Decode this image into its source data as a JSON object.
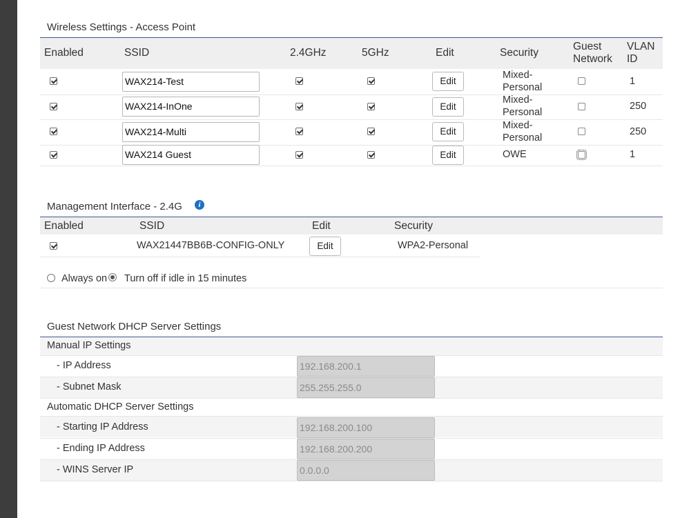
{
  "wireless": {
    "title": "Wireless Settings - Access Point",
    "headers": {
      "enabled": "Enabled",
      "ssid": "SSID",
      "band24": "2.4GHz",
      "band5": "5GHz",
      "edit": "Edit",
      "security": "Security",
      "guest_line1": "Guest",
      "guest_line2": "Network",
      "vlan_line1": "VLAN",
      "vlan_line2": "ID"
    },
    "rows": [
      {
        "enabled": true,
        "ssid": "WAX214-Test",
        "band24": true,
        "band5": true,
        "edit_label": "Edit",
        "security_line1": "Mixed-",
        "security_line2": "Personal",
        "guest": false,
        "vlan": "1"
      },
      {
        "enabled": true,
        "ssid": "WAX214-InOne",
        "band24": true,
        "band5": true,
        "edit_label": "Edit",
        "security_line1": "Mixed-",
        "security_line2": "Personal",
        "guest": false,
        "vlan": "250"
      },
      {
        "enabled": true,
        "ssid": "WAX214-Multi",
        "band24": true,
        "band5": true,
        "edit_label": "Edit",
        "security_line1": "Mixed-",
        "security_line2": "Personal",
        "guest": false,
        "vlan": "250"
      },
      {
        "enabled": true,
        "ssid": "WAX214 Guest",
        "band24": true,
        "band5": true,
        "edit_label": "Edit",
        "security_line1": "OWE",
        "security_line2": "",
        "guest": false,
        "vlan": "1"
      }
    ]
  },
  "management": {
    "title": "Management Interface - 2.4G",
    "info_icon": "info-icon",
    "headers": {
      "enabled": "Enabled",
      "ssid": "SSID",
      "edit": "Edit",
      "security": "Security"
    },
    "row": {
      "enabled": true,
      "ssid": "WAX21447BB6B-CONFIG-ONLY",
      "edit_label": "Edit",
      "security": "WPA2-Personal"
    },
    "radio_always_on": "Always on",
    "radio_turn_off": "Turn off if idle in 15 minutes",
    "selected": "turn_off"
  },
  "dhcp": {
    "title": "Guest Network DHCP Server Settings",
    "manual_label": "Manual IP Settings",
    "ip_label": "- IP Address",
    "ip_value": "192.168.200.1",
    "mask_label": "- Subnet Mask",
    "mask_value": "255.255.255.0",
    "auto_label": "Automatic DHCP Server Settings",
    "start_label": "- Starting IP Address",
    "start_value": "192.168.200.100",
    "end_label": "- Ending IP Address",
    "end_value": "192.168.200.200",
    "wins_label": "- WINS Server IP",
    "wins_value": "0.0.0.0"
  },
  "colors": {
    "rule": "#3a5a8c",
    "header_bg": "#efefef",
    "info_icon": "#1f6fc5",
    "left_bar": "#3d3d3d"
  }
}
